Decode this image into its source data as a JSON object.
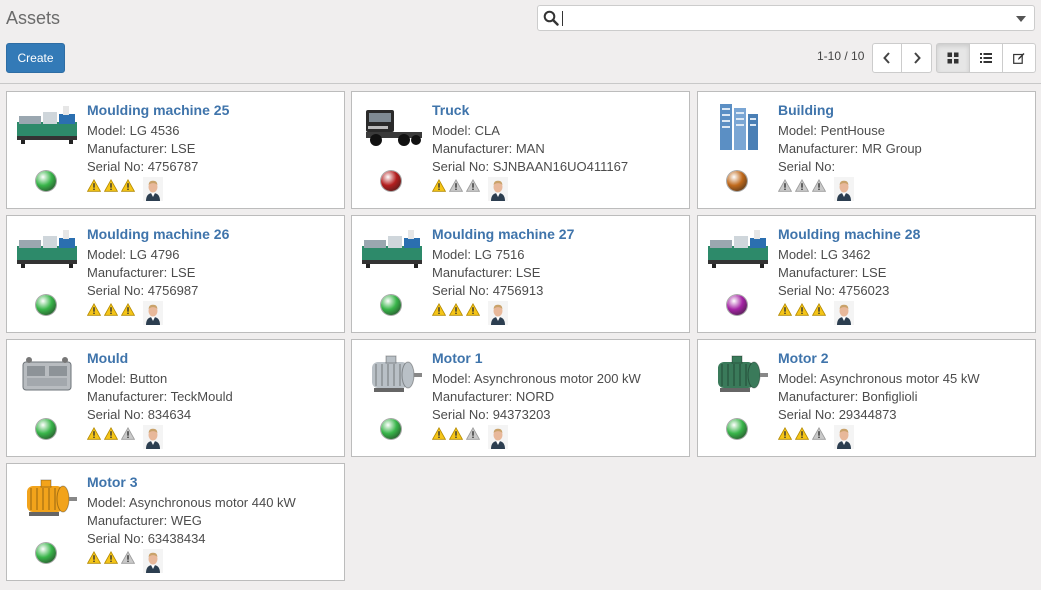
{
  "page": {
    "title": "Assets"
  },
  "search": {
    "value": ""
  },
  "toolbar": {
    "create_label": "Create"
  },
  "pager": {
    "value": "1-10 / 10"
  },
  "view_switcher": {
    "active": "kanban"
  },
  "status_colors": {
    "green": "#39b54a",
    "red": "#b31e1e",
    "orange": "#c06a1c",
    "purple": "#a525a5"
  },
  "assets": [
    {
      "name": "Moulding machine 25",
      "model": "Model: LG 4536",
      "manufacturer": "Manufacturer: LSE",
      "serial": "Serial No: 4756787",
      "status": "green",
      "priority": 3,
      "image": "injection-moulding-machine"
    },
    {
      "name": "Truck",
      "model": "Model: CLA",
      "manufacturer": "Manufacturer: MAN",
      "serial": "Serial No: SJNBAAN16UO411167",
      "status": "red",
      "priority": 1,
      "image": "truck"
    },
    {
      "name": "Building",
      "model": "Model: PentHouse",
      "manufacturer": "Manufacturer: MR Group",
      "serial": "Serial No:",
      "status": "orange",
      "priority": 0,
      "image": "building"
    },
    {
      "name": "Moulding machine 26",
      "model": "Model: LG 4796",
      "manufacturer": "Manufacturer: LSE",
      "serial": "Serial No: 4756987",
      "status": "green",
      "priority": 3,
      "image": "injection-moulding-machine"
    },
    {
      "name": "Moulding machine 27",
      "model": "Model: LG 7516",
      "manufacturer": "Manufacturer: LSE",
      "serial": "Serial No: 4756913",
      "status": "green",
      "priority": 3,
      "image": "injection-moulding-machine"
    },
    {
      "name": "Moulding machine 28",
      "model": "Model: LG 3462",
      "manufacturer": "Manufacturer: LSE",
      "serial": "Serial No: 4756023",
      "status": "purple",
      "priority": 3,
      "image": "injection-moulding-machine"
    },
    {
      "name": "Mould",
      "model": "Model: Button",
      "manufacturer": "Manufacturer: TeckMould",
      "serial": "Serial No: 834634",
      "status": "green",
      "priority": 2,
      "image": "mould"
    },
    {
      "name": "Motor 1",
      "model": "Model: Asynchronous motor 200 kW",
      "manufacturer": "Manufacturer: NORD",
      "serial": "Serial No: 94373203",
      "status": "green",
      "priority": 2,
      "image": "motor"
    },
    {
      "name": "Motor 2",
      "model": "Model: Asynchronous motor 45 kW",
      "manufacturer": "Manufacturer: Bonfiglioli",
      "serial": "Serial No: 29344873",
      "status": "green",
      "priority": 2,
      "image": "motor"
    },
    {
      "name": "Motor 3",
      "model": "Model: Asynchronous motor 440 kW",
      "manufacturer": "Manufacturer: WEG",
      "serial": "Serial No: 63438434",
      "status": "green",
      "priority": 2,
      "image": "motor"
    }
  ]
}
